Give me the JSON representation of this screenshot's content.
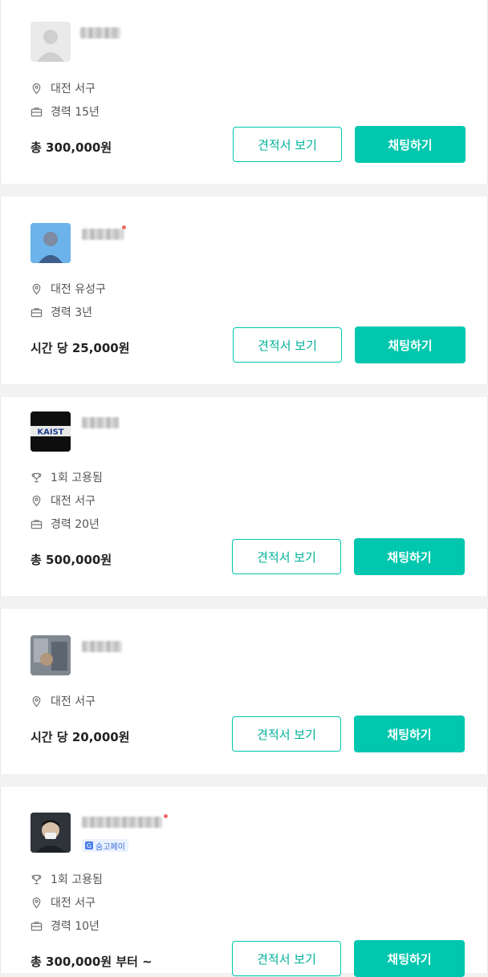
{
  "buttons": {
    "quote": "견적서 보기",
    "chat": "채팅하기"
  },
  "experts": [
    {
      "location": "대전 서구",
      "career": "경력 15년",
      "price": "총 300,000원"
    },
    {
      "location": "대전 유성구",
      "career": "경력 3년",
      "price": "시간 당 25,000원"
    },
    {
      "hired": "1회 고용됨",
      "location": "대전 서구",
      "career": "경력 20년",
      "price": "총 500,000원",
      "logo_text": "KAIST"
    },
    {
      "location": "대전 서구",
      "price": "시간 당 20,000원"
    },
    {
      "badge": "숨고페이",
      "hired": "1회 고용됨",
      "location": "대전 서구",
      "career": "경력 10년",
      "price": "총 300,000원 부터 ~"
    }
  ],
  "colors": {
    "accent": "#00c7ae",
    "background": "#f2f2f2"
  }
}
